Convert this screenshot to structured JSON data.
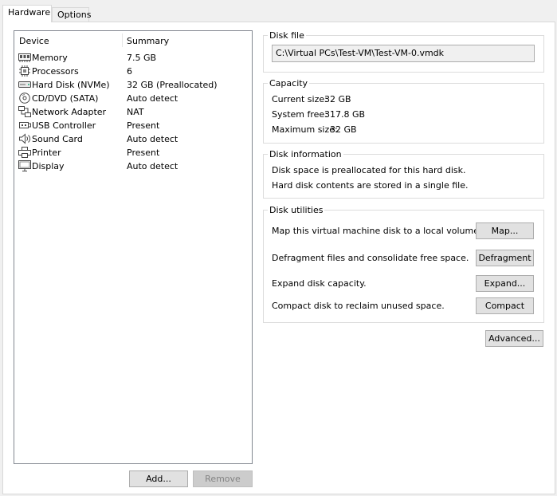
{
  "tabs": [
    {
      "label": "Hardware",
      "active": true
    },
    {
      "label": "Options",
      "active": false
    }
  ],
  "device_list": {
    "columns": [
      "Device",
      "Summary"
    ],
    "rows": [
      {
        "device": "Memory",
        "summary": "7.5 GB",
        "icon": "memory-icon"
      },
      {
        "device": "Processors",
        "summary": "6",
        "icon": "processor-icon"
      },
      {
        "device": "Hard Disk (NVMe)",
        "summary": "32 GB (Preallocated)",
        "icon": "hard-disk-icon"
      },
      {
        "device": "CD/DVD (SATA)",
        "summary": "Auto detect",
        "icon": "cd-dvd-icon"
      },
      {
        "device": "Network Adapter",
        "summary": "NAT",
        "icon": "network-adapter-icon"
      },
      {
        "device": "USB Controller",
        "summary": "Present",
        "icon": "usb-icon"
      },
      {
        "device": "Sound Card",
        "summary": "Auto detect",
        "icon": "speaker-icon"
      },
      {
        "device": "Printer",
        "summary": "Present",
        "icon": "printer-icon"
      },
      {
        "device": "Display",
        "summary": "Auto detect",
        "icon": "monitor-icon"
      }
    ],
    "add_label": "Add...",
    "remove_label": "Remove"
  },
  "disk_file": {
    "title": "Disk file",
    "path": "C:\\Virtual PCs\\Test-VM\\Test-VM-0.vmdk"
  },
  "capacity": {
    "title": "Capacity",
    "current_label": "Current size:",
    "current_value": "32 GB",
    "free_label": "System free:",
    "free_value": "317.8 GB",
    "max_label": "Maximum size:",
    "max_value": "32 GB"
  },
  "disk_information": {
    "title": "Disk information",
    "line1": "Disk space is preallocated for this hard disk.",
    "line2": "Hard disk contents are stored in a single file."
  },
  "disk_utilities": {
    "title": "Disk utilities",
    "map_text": "Map this virtual machine disk to a local volume.",
    "map_button": "Map...",
    "defrag_text": "Defragment files and consolidate free space.",
    "defrag_button": "Defragment",
    "expand_text": "Expand disk capacity.",
    "expand_button": "Expand...",
    "compact_text": "Compact disk to reclaim unused space.",
    "compact_button": "Compact"
  },
  "advanced_button": "Advanced..."
}
